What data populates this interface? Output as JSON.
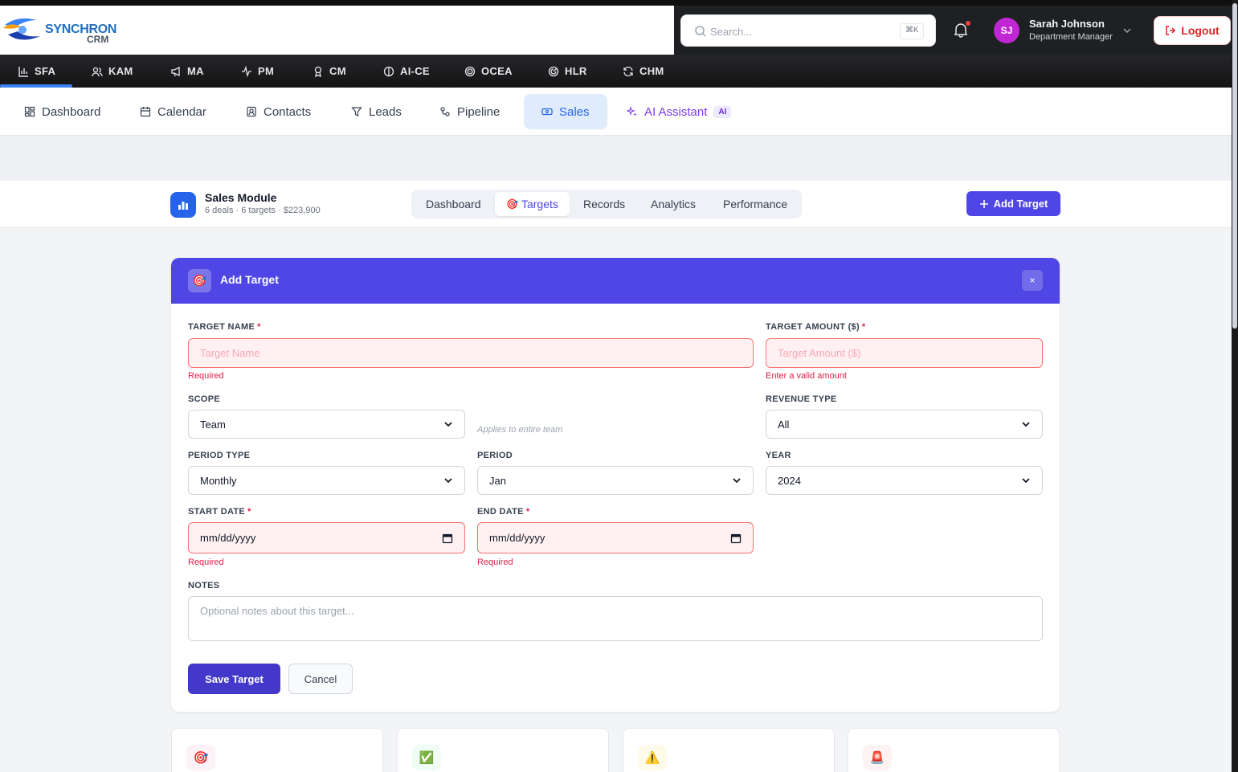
{
  "brand": {
    "name1": "SYNCHRON",
    "name2": "CRM"
  },
  "search": {
    "placeholder": "Search...",
    "shortcut": "⌘K"
  },
  "user": {
    "initials": "SJ",
    "name": "Sarah Johnson",
    "role": "Department Manager"
  },
  "logout_label": "Logout",
  "modules": [
    {
      "label": "SFA",
      "icon": "bar-chart-icon",
      "active": true
    },
    {
      "label": "KAM",
      "icon": "users-icon"
    },
    {
      "label": "MA",
      "icon": "megaphone-icon"
    },
    {
      "label": "PM",
      "icon": "activity-icon"
    },
    {
      "label": "CM",
      "icon": "award-icon"
    },
    {
      "label": "AI-CE",
      "icon": "brain-icon"
    },
    {
      "label": "OCEA",
      "icon": "target-icon"
    },
    {
      "label": "HLR",
      "icon": "radar-icon"
    },
    {
      "label": "CHM",
      "icon": "refresh-icon"
    }
  ],
  "nav": [
    {
      "label": "Dashboard",
      "icon": "grid-icon"
    },
    {
      "label": "Calendar",
      "icon": "calendar-icon"
    },
    {
      "label": "Contacts",
      "icon": "contact-icon"
    },
    {
      "label": "Leads",
      "icon": "filter-icon"
    },
    {
      "label": "Pipeline",
      "icon": "pipeline-icon"
    },
    {
      "label": "Sales",
      "icon": "ticket-icon",
      "active": true
    },
    {
      "label": "AI Assistant",
      "icon": "sparkles-icon",
      "badge": "AI"
    }
  ],
  "sales_module": {
    "title": "Sales Module",
    "subtitle": "6 deals · 6 targets · $223,900",
    "tabs": [
      "Dashboard",
      "Targets",
      "Records",
      "Analytics",
      "Performance"
    ],
    "active_tab": "Targets",
    "add_button": "Add Target"
  },
  "form": {
    "title": "Add Target",
    "target_name": {
      "label": "TARGET NAME",
      "placeholder": "Target Name",
      "error": "Required"
    },
    "target_amount": {
      "label": "TARGET AMOUNT ($)",
      "placeholder": "Target Amount ($)",
      "error": "Enter a valid amount"
    },
    "scope": {
      "label": "SCOPE",
      "value": "Team",
      "hint": "Applies to entire team"
    },
    "revenue_type": {
      "label": "REVENUE TYPE",
      "value": "All"
    },
    "period_type": {
      "label": "PERIOD TYPE",
      "value": "Monthly"
    },
    "period": {
      "label": "PERIOD",
      "value": "Jan"
    },
    "year": {
      "label": "YEAR",
      "value": "2024"
    },
    "start_date": {
      "label": "START DATE",
      "value": "mm/dd/yyyy",
      "error": "Required"
    },
    "end_date": {
      "label": "END DATE",
      "value": "mm/dd/yyyy",
      "error": "Required"
    },
    "notes": {
      "label": "NOTES",
      "placeholder": "Optional notes about this target..."
    },
    "required_mark": "*",
    "save_label": "Save Target",
    "cancel_label": "Cancel",
    "close_label": "×"
  },
  "stat_cards": [
    {
      "icon": "target-icon",
      "glyph": "🎯",
      "bg": "#fdf2f8"
    },
    {
      "icon": "check-icon",
      "glyph": "✅",
      "bg": "#f0fdf4"
    },
    {
      "icon": "warning-icon",
      "glyph": "⚠️",
      "bg": "#fffbeb"
    },
    {
      "icon": "siren-icon",
      "glyph": "🚨",
      "bg": "#fef2f2"
    }
  ],
  "colors": {
    "accent": "#4f46e5",
    "primary": "#2563eb",
    "error": "#e11d48"
  }
}
